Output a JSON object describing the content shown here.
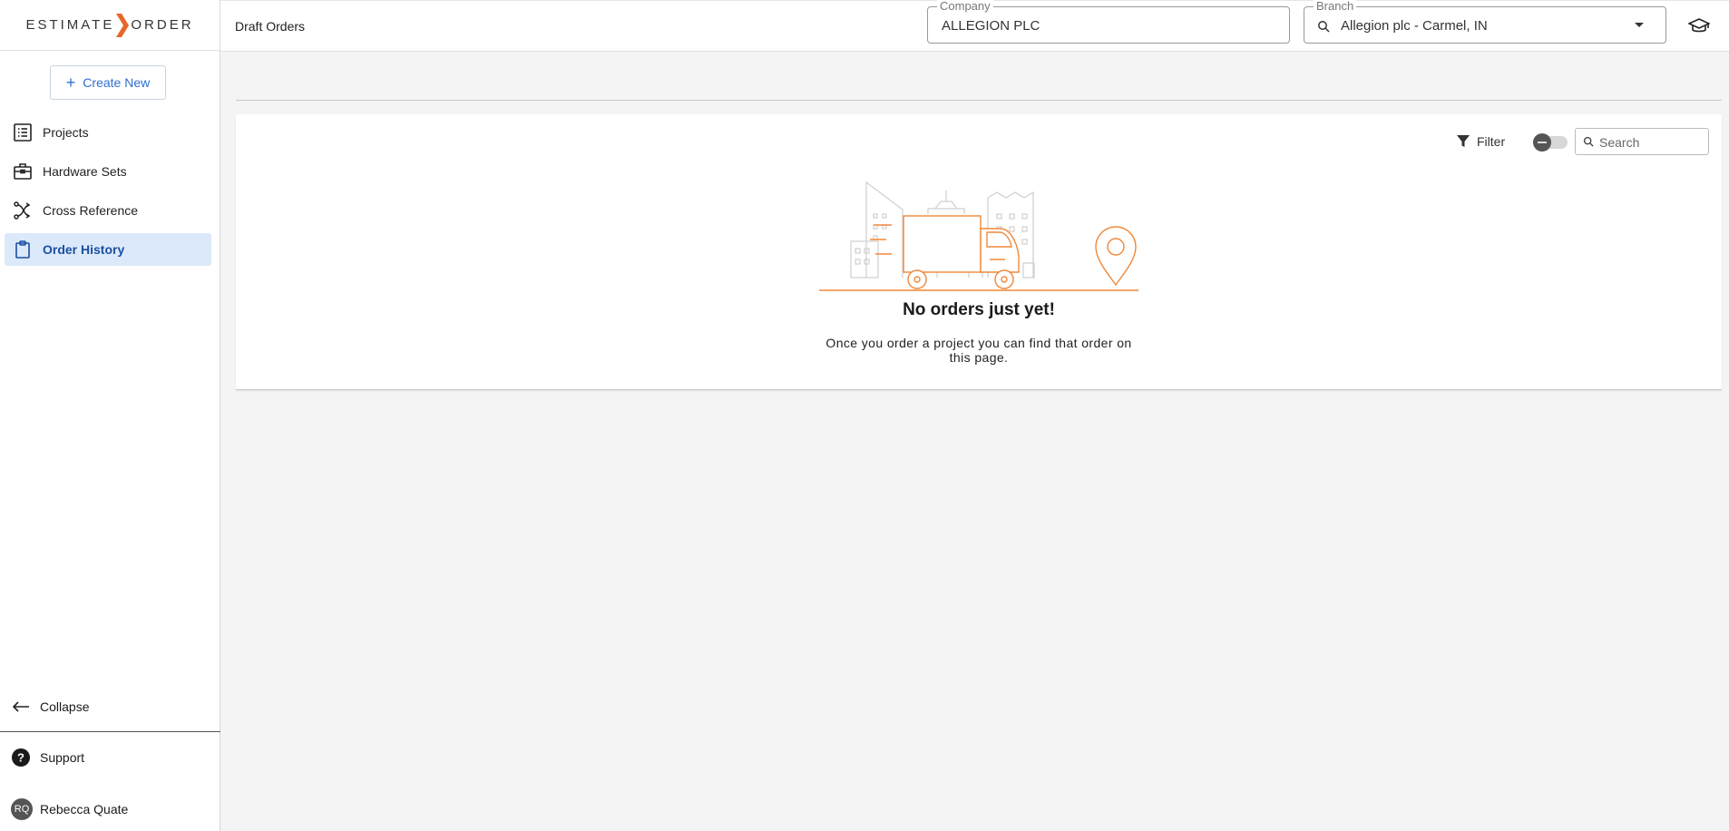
{
  "brand": {
    "left": "ESTIMATE",
    "right": "ORDER",
    "accent": "#e8662a"
  },
  "sidebar": {
    "create_label": "Create New",
    "items": [
      {
        "label": "Projects",
        "icon": "list-icon",
        "active": false
      },
      {
        "label": "Hardware Sets",
        "icon": "briefcase-icon",
        "active": false
      },
      {
        "label": "Cross Reference",
        "icon": "cross-reference-icon",
        "active": false
      },
      {
        "label": "Order History",
        "icon": "clipboard-icon",
        "active": true
      }
    ],
    "collapse_label": "Collapse",
    "support_label": "Support",
    "user": {
      "initials": "RQ",
      "name": "Rebecca Quate"
    }
  },
  "header": {
    "page_title": "Draft Orders",
    "company": {
      "label": "Company",
      "value": "ALLEGION PLC"
    },
    "branch": {
      "label": "Branch",
      "value": "Allegion plc - Carmel, IN"
    }
  },
  "toolbar": {
    "filter_label": "Filter",
    "search_placeholder": "Search"
  },
  "empty_state": {
    "title": "No orders just yet!",
    "text": "Once you order a project you can find that order on this page."
  },
  "colors": {
    "active_bg": "#dce9fb",
    "active_text": "#1d4f9e",
    "link_blue": "#2f6fd1",
    "illustration": "#f0883a"
  }
}
